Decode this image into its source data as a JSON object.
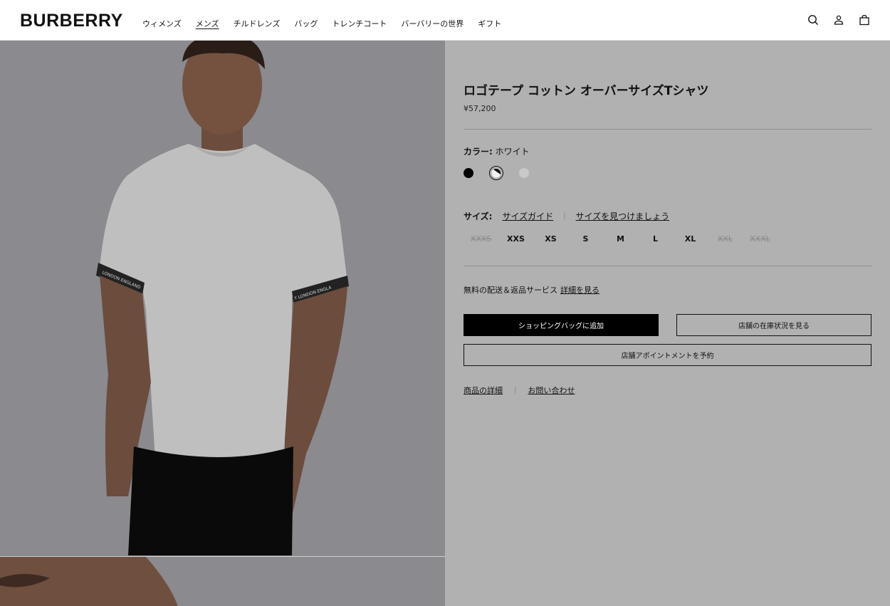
{
  "brand": "BURBERRY",
  "nav": {
    "items": [
      "ウィメンズ",
      "メンズ",
      "チルドレンズ",
      "バッグ",
      "トレンチコート",
      "バーバリーの世界",
      "ギフト"
    ],
    "active_index": 1
  },
  "header_icons": [
    "search-icon",
    "account-icon",
    "shopping-bag-icon"
  ],
  "product": {
    "title": "ロゴテープ コットン オーバーサイズTシャツ",
    "price": "¥57,200",
    "color_label": "カラー:",
    "color_value": "ホワイト",
    "swatches": [
      {
        "name": "black",
        "color": "#000000"
      },
      {
        "name": "white",
        "color": "#f2f2f2",
        "selected": true
      },
      {
        "name": "grey",
        "color": "#c9c9c9"
      }
    ],
    "size_label": "サイズ:",
    "size_guide": "サイズガイド",
    "find_size": "サイズを見つけましょう",
    "sizes": [
      {
        "label": "XXXS",
        "available": false
      },
      {
        "label": "XXS",
        "available": true
      },
      {
        "label": "XS",
        "available": true
      },
      {
        "label": "S",
        "available": true
      },
      {
        "label": "M",
        "available": true
      },
      {
        "label": "L",
        "available": true
      },
      {
        "label": "XL",
        "available": true
      },
      {
        "label": "XXL",
        "available": false
      },
      {
        "label": "XXXL",
        "available": false
      }
    ],
    "delivery_text": "無料の配送＆返品サービス",
    "delivery_link": "詳細を見る",
    "add_to_bag": "ショッピングバッグに追加",
    "store_stock": "店舗の在庫状況を見る",
    "book_appointment": "店舗アポイントメントを予約",
    "product_details": "商品の詳細",
    "contact": "お問い合わせ"
  },
  "image": {
    "sleeve_text_left": "LONDON ENGLAND",
    "sleeve_text_right": "Y LONDON ENGLA"
  },
  "colors": {
    "overlay_grey": "#b1b1b1",
    "text_dark": "#111111"
  }
}
